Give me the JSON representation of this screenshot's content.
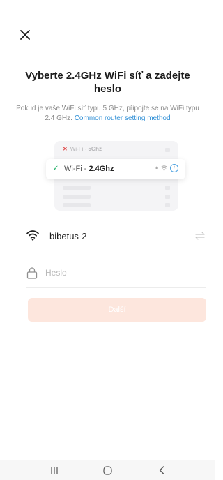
{
  "header": {
    "close_icon": "close-icon"
  },
  "title": "Vyberte 2.4GHz WiFi síť a zadejte heslo",
  "subtitle": {
    "text": "Pokud je vaše WiFi síť typu 5 GHz, připojte se na WiFi typu 2.4 GHz.",
    "link": "Common router setting method",
    "link_color": "#2f8fd6"
  },
  "illustration": {
    "row_5g_prefix": "Wi-Fi - ",
    "row_5g_band": "5Ghz",
    "row_24g_prefix": "Wi-Fi - ",
    "row_24g_band": "2.4Ghz"
  },
  "wifi": {
    "ssid": "bibetus-2",
    "icon": "wifi-icon",
    "switch_icon": "switch-network-icon"
  },
  "password": {
    "placeholder": "Heslo",
    "value": "",
    "icon": "lock-icon"
  },
  "next_button": {
    "label": "Další",
    "color": "#fde6dd"
  },
  "navbar": {
    "recent": "recent-apps-icon",
    "home": "home-icon",
    "back": "back-icon"
  }
}
